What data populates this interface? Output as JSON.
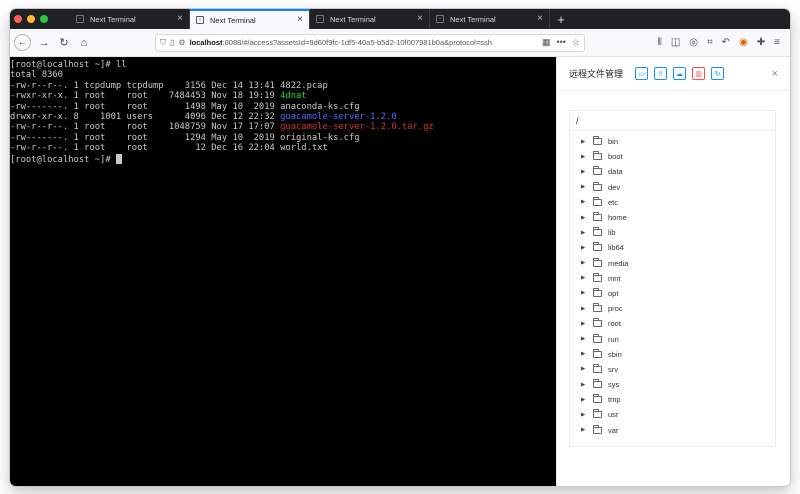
{
  "tabs": [
    {
      "title": "Next Terminal",
      "active": false
    },
    {
      "title": "Next Terminal",
      "active": true
    },
    {
      "title": "Next Terminal",
      "active": false
    },
    {
      "title": "Next Terminal",
      "active": false
    }
  ],
  "tab_close_glyph": "×",
  "new_tab_glyph": "+",
  "url": {
    "host": "localhost",
    "rest": ":8088/#/access?assetsId=9d60f9fc-1df5-40a5-b5d2-10f007981b0a&protocol=ssh"
  },
  "terminal": {
    "lines": [
      {
        "text": "[root@localhost ~]# ll"
      },
      {
        "text": "total 8360"
      },
      {
        "prefix": "-rw-r--r--. 1 tcpdump tcpdump    3156 Dec 14 13:41 ",
        "name": "4822.pcap",
        "color": "default"
      },
      {
        "prefix": "-rwxr-xr-x. 1 root    root    7484453 Nov 18 19:19 ",
        "name": "4dnat",
        "color": "green"
      },
      {
        "prefix": "-rw-------. 1 root    root       1498 May 10  2019 ",
        "name": "anaconda-ks.cfg",
        "color": "default"
      },
      {
        "prefix": "drwxr-xr-x. 8    1001 users      4096 Dec 12 22:32 ",
        "name": "guacamole-server-1.2.0",
        "color": "blue"
      },
      {
        "prefix": "-rw-r--r--. 1 root    root    1048759 Nov 17 17:07 ",
        "name": "guacamole-server-1.2.0.tar.gz",
        "color": "red"
      },
      {
        "prefix": "-rw-------. 1 root    root       1294 May 10  2019 ",
        "name": "original-ks.cfg",
        "color": "default"
      },
      {
        "prefix": "-rw-r--r--. 1 root    root         12 Dec 16 22:04 ",
        "name": "world.txt",
        "color": "default"
      }
    ],
    "prompt": "[root@localhost ~]# "
  },
  "panel": {
    "title": "远程文件管理",
    "close_glyph": "×",
    "path": "/",
    "folders": [
      "bin",
      "boot",
      "data",
      "dev",
      "etc",
      "home",
      "lib",
      "lib64",
      "media",
      "mnt",
      "opt",
      "proc",
      "root",
      "run",
      "sbin",
      "srv",
      "sys",
      "tmp",
      "usr",
      "var"
    ]
  },
  "colors": {
    "tab_accent": "#0a84ff",
    "primary": "#1890ff",
    "danger": "#ff4d4f",
    "term_green": "#1cdc3c",
    "term_blue": "#4a6dff",
    "term_red": "#d3322f"
  }
}
